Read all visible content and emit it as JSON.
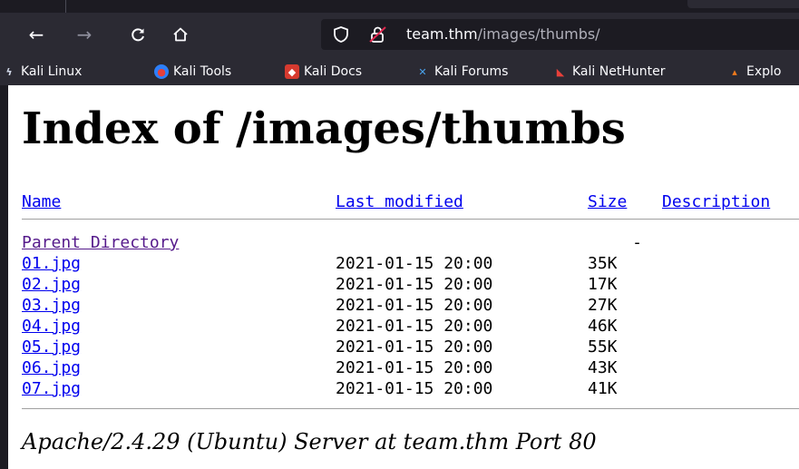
{
  "browser": {
    "url_host": "team.thm",
    "url_path": "/images/thumbs/",
    "bookmarks": [
      {
        "label": "Kali Linux",
        "icon": "kali-dragon-icon"
      },
      {
        "label": "Kali Tools",
        "icon": "kali-tools-icon"
      },
      {
        "label": "Kali Docs",
        "icon": "kali-docs-icon"
      },
      {
        "label": "Kali Forums",
        "icon": "kali-forums-icon"
      },
      {
        "label": "Kali NetHunter",
        "icon": "kali-nethunter-icon"
      },
      {
        "label": "Explo",
        "icon": "exploit-db-icon"
      }
    ]
  },
  "page": {
    "title": "Index of /images/thumbs",
    "columns": {
      "name": "Name",
      "modified": "Last modified",
      "size": "Size",
      "description": "Description"
    },
    "parent": {
      "name": "Parent Directory",
      "size": "-"
    },
    "files": [
      {
        "name": "01.jpg",
        "modified": "2021-01-15 20:00",
        "size": "35K"
      },
      {
        "name": "02.jpg",
        "modified": "2021-01-15 20:00",
        "size": "17K"
      },
      {
        "name": "03.jpg",
        "modified": "2021-01-15 20:00",
        "size": "27K"
      },
      {
        "name": "04.jpg",
        "modified": "2021-01-15 20:00",
        "size": "46K"
      },
      {
        "name": "05.jpg",
        "modified": "2021-01-15 20:00",
        "size": "55K"
      },
      {
        "name": "06.jpg",
        "modified": "2021-01-15 20:00",
        "size": "43K"
      },
      {
        "name": "07.jpg",
        "modified": "2021-01-15 20:00",
        "size": "41K"
      }
    ],
    "footer": "Apache/2.4.29 (Ubuntu) Server at team.thm Port 80"
  }
}
